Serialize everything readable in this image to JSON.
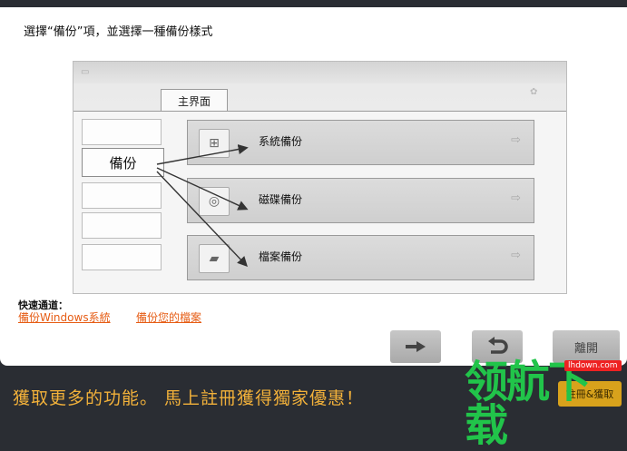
{
  "instruction": "選擇“備份”項，並選擇一種備份樣式",
  "preview": {
    "tab_label": "主界面",
    "left_active_label": "備份",
    "options": [
      {
        "label": "系統備份",
        "icon": "windows-logo-icon"
      },
      {
        "label": "磁碟備份",
        "icon": "disk-icon"
      },
      {
        "label": "檔案備份",
        "icon": "folder-icon"
      }
    ]
  },
  "quick_access": {
    "title": "快速通道：",
    "links": [
      "備份Windows系統",
      "備份您的檔案"
    ]
  },
  "buttons": {
    "next_icon": "arrow-right-icon",
    "back_icon": "undo-arrow-icon",
    "exit_label": "離開"
  },
  "promo": {
    "text": "獲取更多的功能。 馬上註冊獲得獨家優惠！",
    "button_label": "註冊&獲取"
  },
  "watermark": {
    "text": "领航下载",
    "url": "lhdown.com"
  },
  "colors": {
    "link": "#e65c14",
    "promo_text": "#f2b13a",
    "watermark": "#21c44a"
  }
}
